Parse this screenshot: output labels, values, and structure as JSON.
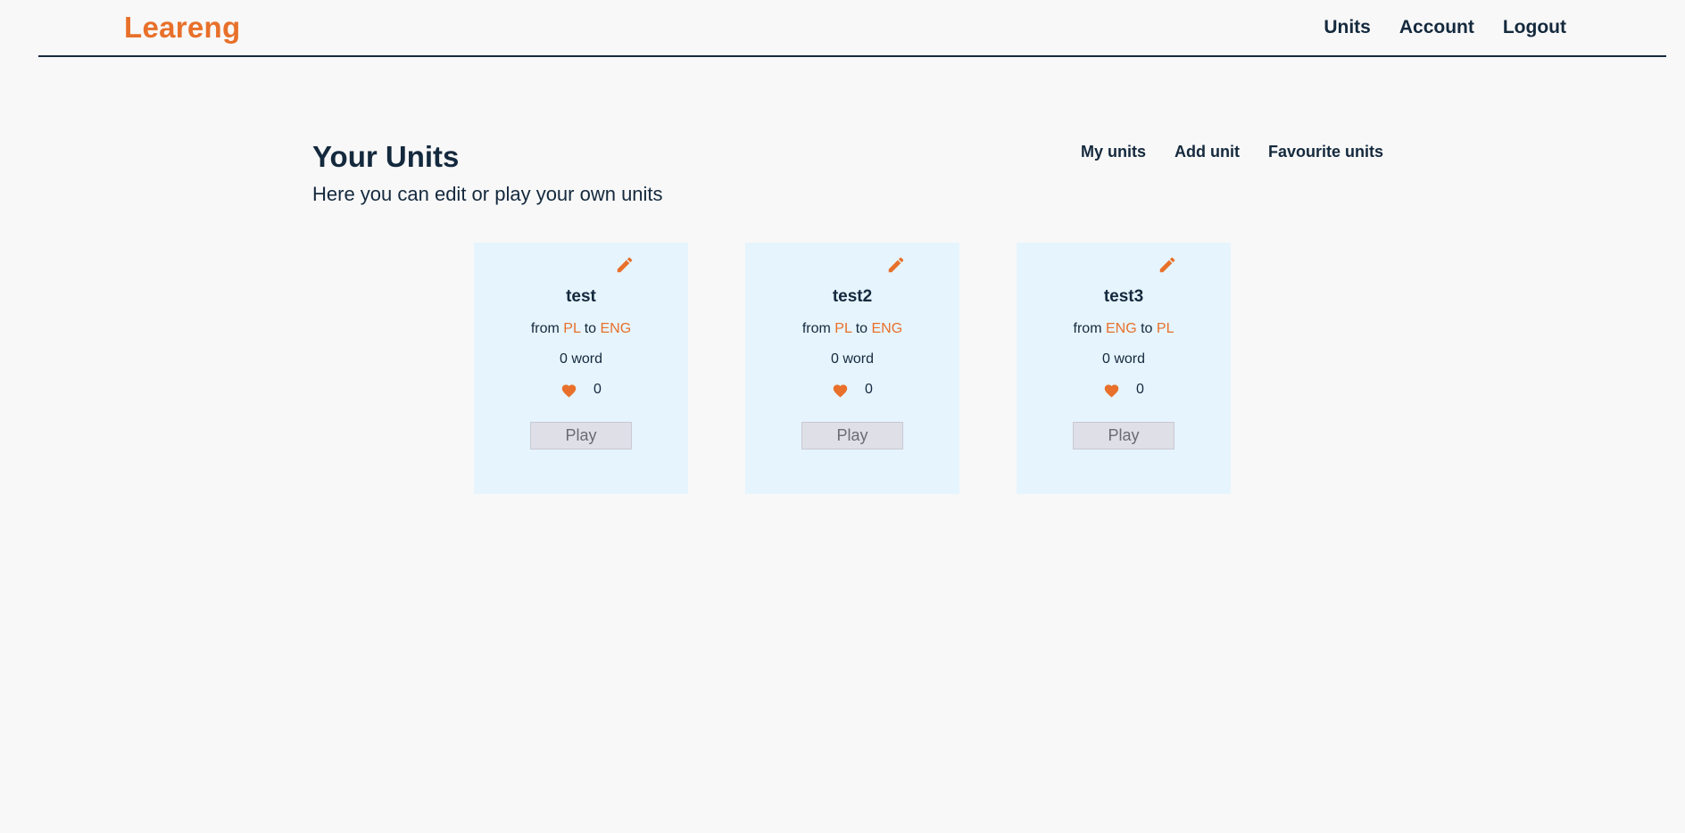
{
  "header": {
    "logo": "Leareng",
    "nav": [
      "Units",
      "Account",
      "Logout"
    ]
  },
  "page": {
    "title": "Your Units",
    "subtitle": "Here you can edit or play your own units"
  },
  "subnav": [
    "My units",
    "Add unit",
    "Favourite units"
  ],
  "units": [
    {
      "title": "test",
      "from_word": "from",
      "from_lang": "PL",
      "to_word": "to",
      "to_lang": "ENG",
      "words": "0 word",
      "likes": "0",
      "play_label": "Play"
    },
    {
      "title": "test2",
      "from_word": "from",
      "from_lang": "PL",
      "to_word": "to",
      "to_lang": "ENG",
      "words": "0 word",
      "likes": "0",
      "play_label": "Play"
    },
    {
      "title": "test3",
      "from_word": "from",
      "from_lang": "ENG",
      "to_word": "to",
      "to_lang": "PL",
      "words": "0 word",
      "likes": "0",
      "play_label": "Play"
    }
  ],
  "colors": {
    "accent": "#e8702a",
    "text": "#14293d",
    "card_bg": "#e6f4fd",
    "page_bg": "#f8f8f8",
    "button_bg": "#dfdfe7"
  },
  "icons": {
    "edit": "pencil-icon",
    "like": "heart-icon"
  }
}
